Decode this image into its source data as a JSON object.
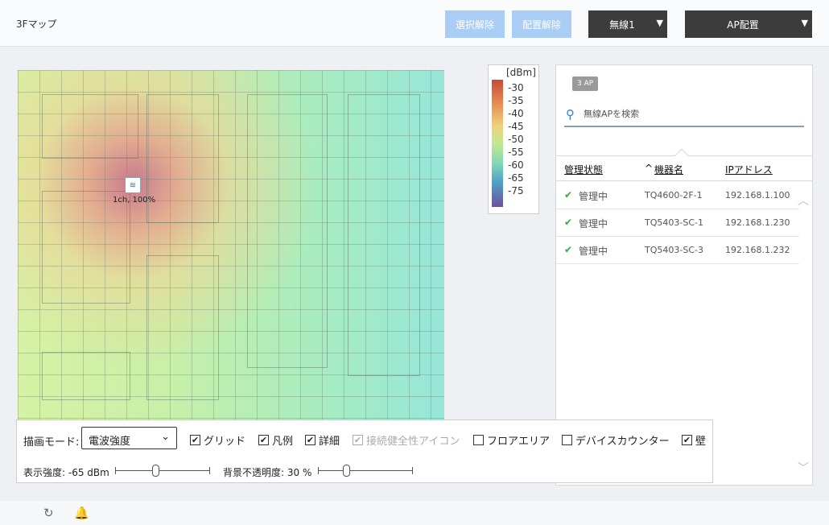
{
  "header": {
    "title": "3Fマップ",
    "deselect_label": "選択解除",
    "unplace_label": "配置解除",
    "radio_select": "無線1",
    "ap_place": "AP配置"
  },
  "legend": {
    "unit": "[dBm]",
    "ticks": [
      "-30",
      "-35",
      "-40",
      "-45",
      "-50",
      "-55",
      "-60",
      "-65",
      "-75"
    ]
  },
  "map": {
    "ap_label": "1ch, 100%",
    "ap_icon": "wifi-icon"
  },
  "panel": {
    "count_badge": "3 AP",
    "search_placeholder": "無線APを検索",
    "columns": [
      "管理状態",
      "機器名",
      "IPアドレス"
    ],
    "sort_indicator": "^",
    "rows": [
      {
        "status": "管理中",
        "name": "TQ4600-2F-1",
        "ip": "192.168.1.100"
      },
      {
        "status": "管理中",
        "name": "TQ5403-SC-1",
        "ip": "192.168.1.230"
      },
      {
        "status": "管理中",
        "name": "TQ5403-SC-3",
        "ip": "192.168.1.232"
      }
    ]
  },
  "controls": {
    "mode_label": "描画モード:",
    "mode_value": "電波強度",
    "checkboxes": [
      {
        "label": "グリッド",
        "checked": true
      },
      {
        "label": "凡例",
        "checked": true
      },
      {
        "label": "詳細",
        "checked": true
      },
      {
        "label": "接続健全性アイコン",
        "checked": true,
        "disabled": true
      },
      {
        "label": "フロアエリア",
        "checked": false
      },
      {
        "label": "デバイスカウンター",
        "checked": false
      },
      {
        "label": "壁",
        "checked": true
      }
    ],
    "strength_label": "表示強度: -65 dBm",
    "strength_value_fraction": 0.42,
    "opacity_label": "背景不透明度: 30 %",
    "opacity_value_fraction": 0.3
  },
  "footer": {
    "refresh_icon": "refresh-icon",
    "bell_icon": "bell-icon"
  }
}
